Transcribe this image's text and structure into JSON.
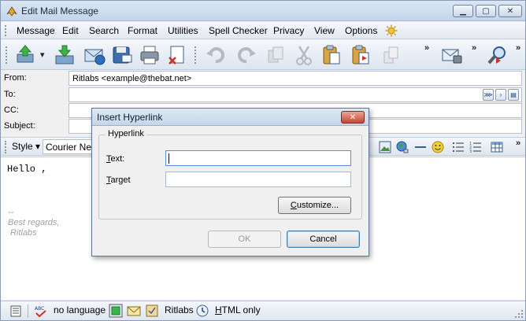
{
  "window": {
    "title": "Edit Mail Message"
  },
  "menu": {
    "items": [
      "Message",
      "Edit",
      "Search",
      "Format",
      "Utilities",
      "Spell Checker",
      "Privacy",
      "View",
      "Options"
    ]
  },
  "toolbar": {
    "overflow": "»"
  },
  "header": {
    "from_label": "From:",
    "from_value": "Ritlabs <example@thebat.net>",
    "to_label": "To:",
    "cc_label": "CC:",
    "subject_label": "Subject:"
  },
  "format_bar": {
    "style_label": "Style",
    "font_value": "Courier New"
  },
  "editor": {
    "greeting": "Hello ,",
    "sig_dashes": "--",
    "sig_line1": "Best regards,",
    "sig_line2": " Ritlabs"
  },
  "status": {
    "language": "no language",
    "account": "Ritlabs",
    "mode_accel": "H",
    "mode_rest": "TML only"
  },
  "dialog": {
    "title": "Insert Hyperlink",
    "group_title": "Hyperlink",
    "text_label_accel": "T",
    "text_label_rest": "ext:",
    "text_value": "",
    "target_label_accel": "T",
    "target_label_rest": "arget",
    "target_value": "",
    "customize_accel": "C",
    "customize_rest": "ustomize...",
    "ok_label": "OK",
    "cancel_label": "Cancel"
  }
}
